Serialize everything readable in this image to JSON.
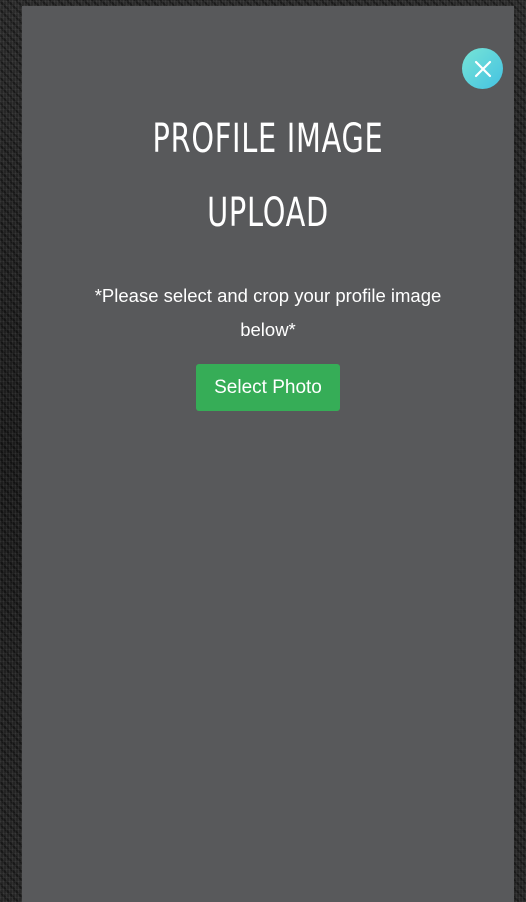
{
  "modal": {
    "title_line1": "PROFILE IMAGE",
    "title_line2": "UPLOAD",
    "instructions": "*Please select and crop your profile image below*",
    "select_photo_label": "Select Photo",
    "close_icon": "close-icon"
  },
  "colors": {
    "modal_background": "#58595b",
    "close_button_gradient_start": "#77e4d6",
    "close_button_gradient_end": "#44c2e2",
    "select_button": "#36ad57",
    "text": "#ffffff"
  }
}
